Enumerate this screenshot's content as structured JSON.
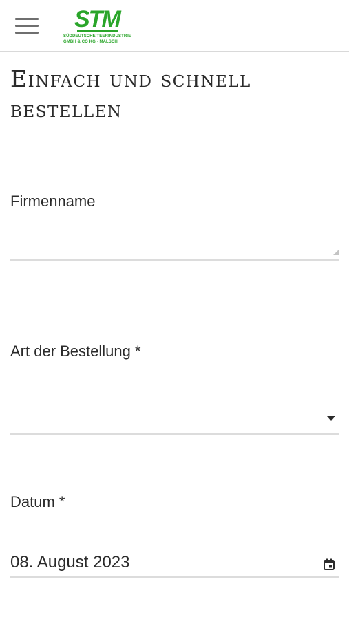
{
  "header": {
    "logo": {
      "mark": "STM",
      "line1": "SÜDDEUTSCHE TEERINDUSTRIE",
      "line2": "GMBH & CO KG · MALSCH",
      "brand_color": "#2aa52a"
    },
    "menu_icon": "hamburger-menu-icon"
  },
  "page": {
    "title": "Einfach und schnell bestellen"
  },
  "form": {
    "company": {
      "label": "Firmenname",
      "value": ""
    },
    "order_type": {
      "label": "Art der Bestellung *",
      "selected": "",
      "icon": "caret-down-icon"
    },
    "date": {
      "label": "Datum *",
      "value": "08. August 2023",
      "icon": "calendar-icon"
    }
  },
  "colors": {
    "text": "#2b2b2b",
    "divider": "#dcdcdc",
    "accent": "#2aa52a"
  }
}
